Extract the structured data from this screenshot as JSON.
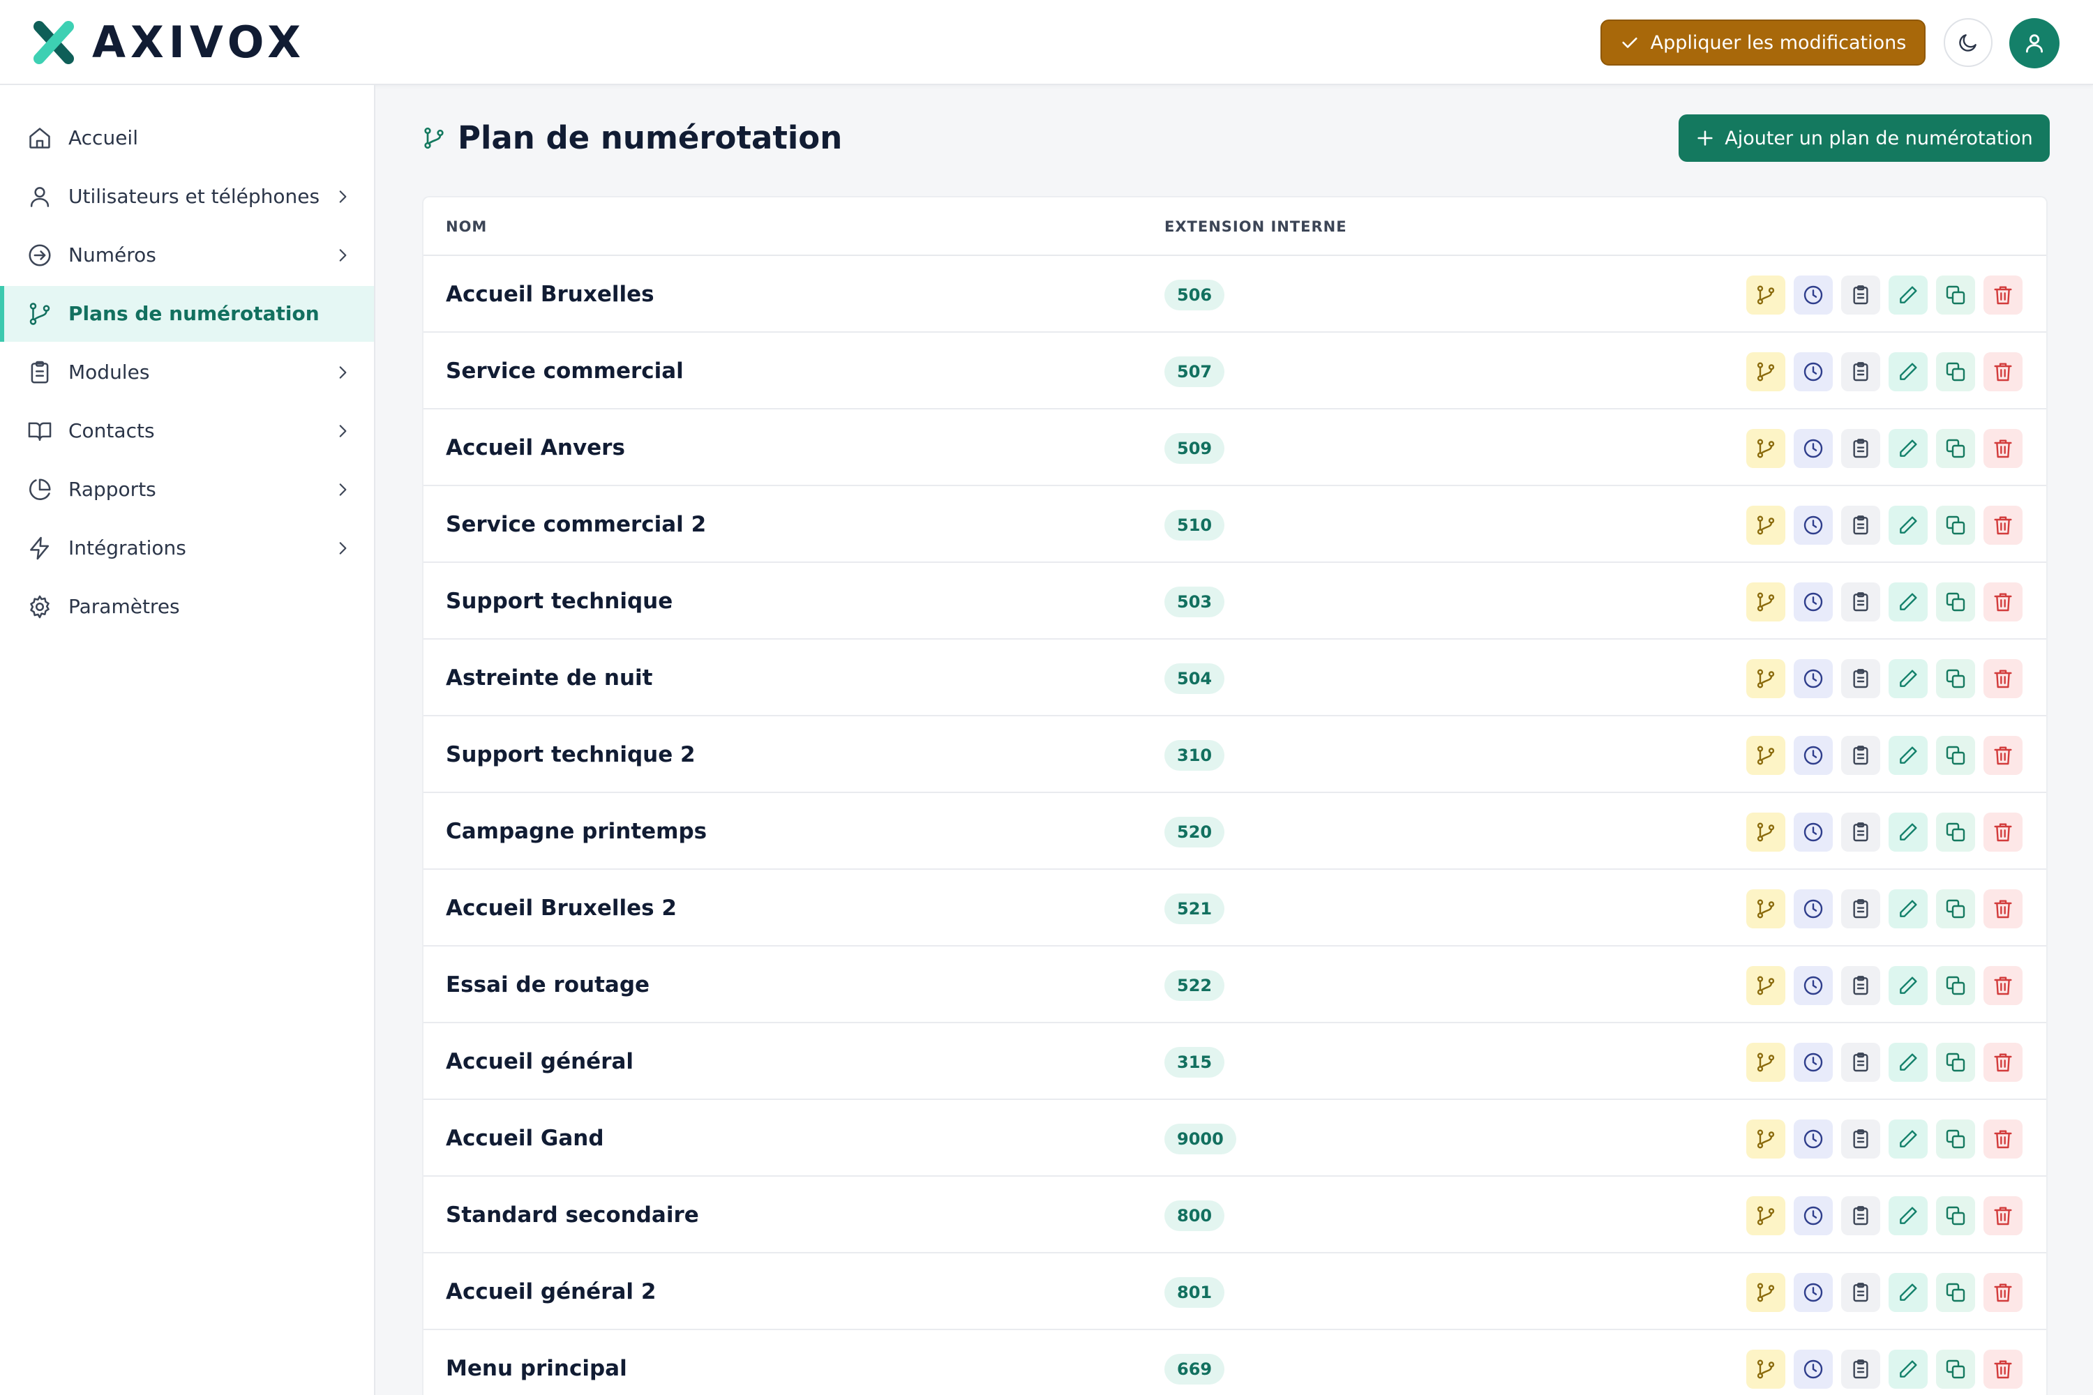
{
  "app": {
    "name": "AXIVOX"
  },
  "header": {
    "apply_label": "Appliquer les modifications",
    "apply_icon": "check-icon",
    "theme_icon": "moon-icon",
    "avatar_icon": "user-icon",
    "colors": {
      "apply": "#a8680a",
      "avatar": "#148069"
    }
  },
  "sidebar": {
    "items": [
      {
        "label": "Accueil",
        "icon": "home-icon",
        "has_children": false,
        "active": false
      },
      {
        "label": "Utilisateurs et téléphones",
        "icon": "user-icon",
        "has_children": true,
        "active": false
      },
      {
        "label": "Numéros",
        "icon": "arrow-circle-icon",
        "has_children": true,
        "active": false
      },
      {
        "label": "Plans de numérotation",
        "icon": "git-branch-icon",
        "has_children": false,
        "active": true
      },
      {
        "label": "Modules",
        "icon": "clipboard-icon",
        "has_children": true,
        "active": false
      },
      {
        "label": "Contacts",
        "icon": "book-icon",
        "has_children": true,
        "active": false
      },
      {
        "label": "Rapports",
        "icon": "pie-chart-icon",
        "has_children": true,
        "active": false
      },
      {
        "label": "Intégrations",
        "icon": "zap-icon",
        "has_children": true,
        "active": false
      },
      {
        "label": "Paramètres",
        "icon": "settings-icon",
        "has_children": false,
        "active": false
      }
    ]
  },
  "page": {
    "title": "Plan de numérotation",
    "title_icon": "git-branch-icon",
    "add_label": "Ajouter un plan de numérotation",
    "add_icon": "plus-icon",
    "colors": {
      "accent": "#14795f",
      "active_bg": "#e5f7f4"
    }
  },
  "table": {
    "columns": [
      "NOM",
      "EXTENSION INTERNE"
    ],
    "row_actions": [
      "git-branch-icon",
      "clock-icon",
      "clipboard-icon",
      "pencil-icon",
      "copy-icon",
      "trash-icon"
    ],
    "rows": [
      {
        "name": "Accueil Bruxelles",
        "extension": "506"
      },
      {
        "name": "Service commercial",
        "extension": "507"
      },
      {
        "name": "Accueil Anvers",
        "extension": "509"
      },
      {
        "name": "Service commercial 2",
        "extension": "510"
      },
      {
        "name": "Support technique",
        "extension": "503"
      },
      {
        "name": "Astreinte de nuit",
        "extension": "504"
      },
      {
        "name": "Support technique 2",
        "extension": "310"
      },
      {
        "name": "Campagne printemps",
        "extension": "520"
      },
      {
        "name": "Accueil Bruxelles 2",
        "extension": "521"
      },
      {
        "name": "Essai de routage",
        "extension": "522"
      },
      {
        "name": "Accueil général",
        "extension": "315"
      },
      {
        "name": "Accueil Gand",
        "extension": "9000"
      },
      {
        "name": "Standard secondaire",
        "extension": "800"
      },
      {
        "name": "Accueil général 2",
        "extension": "801"
      },
      {
        "name": "Menu principal",
        "extension": "669"
      }
    ]
  }
}
